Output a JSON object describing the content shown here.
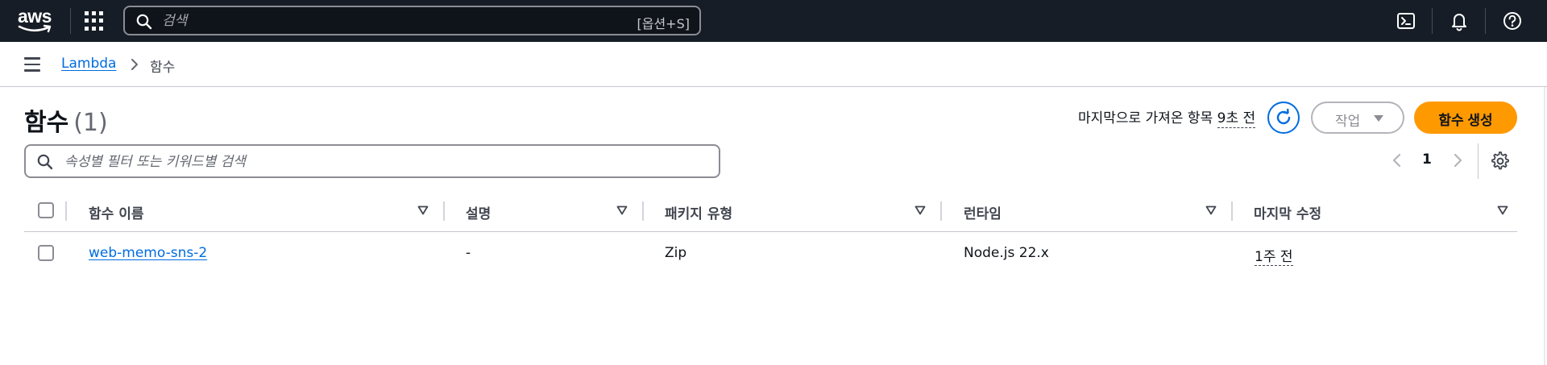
{
  "topnav": {
    "logo_text": "aws",
    "search_placeholder": "검색",
    "search_shortcut": "[옵션+S]"
  },
  "breadcrumb": {
    "service": "Lambda",
    "current": "함수"
  },
  "header": {
    "title": "함수",
    "count": "(1)",
    "last_fetched_prefix": "마지막으로 가져온 항목",
    "last_fetched_ago": "9초 전",
    "actions_label": "작업",
    "create_label": "함수 생성"
  },
  "filter": {
    "placeholder": "속성별 필터 또는 키워드별 검색"
  },
  "pagination": {
    "current_page": "1"
  },
  "table": {
    "columns": [
      "함수 이름",
      "설명",
      "패키지 유형",
      "런타임",
      "마지막 수정"
    ],
    "rows": [
      {
        "name": "web-memo-sns-2",
        "description": "-",
        "package_type": "Zip",
        "runtime": "Node.js 22.x",
        "last_modified": "1주 전"
      }
    ]
  },
  "colors": {
    "nav_bg": "#161d26",
    "link": "#006ce0",
    "primary_button": "#ff9900"
  }
}
